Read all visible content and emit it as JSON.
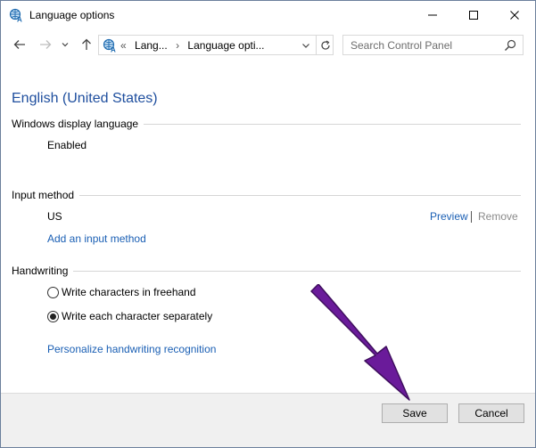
{
  "window": {
    "title": "Language options",
    "icon": "language-globe-icon"
  },
  "titlebar_buttons": {
    "minimize": "minimize-icon",
    "maximize": "maximize-icon",
    "close": "close-icon"
  },
  "navigation": {
    "back_icon": "arrow-left-icon",
    "forward_icon": "arrow-right-icon",
    "recent_icon": "chevron-down-icon",
    "up_icon": "arrow-up-icon",
    "breadcrumb": {
      "overflow": "«",
      "items": [
        "Lang...",
        "Language opti..."
      ],
      "separator": "›"
    },
    "refresh_icon": "refresh-icon"
  },
  "search": {
    "placeholder": "Search Control Panel",
    "value": "",
    "icon": "search-icon"
  },
  "language": {
    "name": "English (United States)"
  },
  "display_language": {
    "header": "Windows display language",
    "status": "Enabled"
  },
  "input_method": {
    "header": "Input method",
    "current": "US",
    "preview_link": "Preview",
    "separator": "|",
    "remove_link": "Remove",
    "add_link": "Add an input method"
  },
  "handwriting": {
    "header": "Handwriting",
    "options": [
      {
        "label": "Write characters in freehand",
        "selected": false
      },
      {
        "label": "Write each character separately",
        "selected": true
      }
    ],
    "personalize_link": "Personalize handwriting recognition"
  },
  "footer": {
    "save_label": "Save",
    "cancel_label": "Cancel"
  },
  "colors": {
    "link": "#1a5fb4",
    "heading": "#1e4e9e",
    "annotation_arrow": "#6a1b9a"
  }
}
